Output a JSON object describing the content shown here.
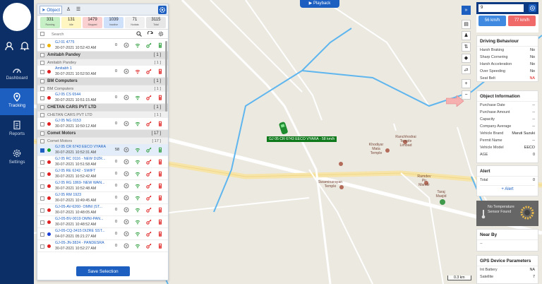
{
  "nav": {
    "items": [
      {
        "label": "Dashboard",
        "icon": "dashboard-icon"
      },
      {
        "label": "Tracking",
        "icon": "tracking-icon"
      },
      {
        "label": "Reports",
        "icon": "reports-icon"
      },
      {
        "label": "Settings",
        "icon": "gear-icon"
      }
    ],
    "active": "Tracking"
  },
  "playback_label": "Playback",
  "panel": {
    "tab_label": "Object",
    "stats": [
      {
        "value": "331",
        "label": "Running",
        "color": "#c7efc5"
      },
      {
        "value": "131",
        "label": "Idle",
        "color": "#fff6c2"
      },
      {
        "value": "1479",
        "label": "Stopped",
        "color": "#fbd0d0"
      },
      {
        "value": "1039",
        "label": "Inactive",
        "color": "#cfe0fa"
      },
      {
        "value": "71",
        "label": "Nodata",
        "color": "#f0f0f0"
      },
      {
        "value": "3115",
        "label": "Total",
        "color": "#e6e6e6"
      }
    ],
    "search_placeholder": "Search",
    "rows": [
      {
        "kind": "veh",
        "name": "GJ 01 4775",
        "time": "30-07-2021 10:52:43 AM",
        "speed": "0",
        "color": "#f0b400"
      },
      {
        "kind": "grp",
        "name": "Amitabh Pandey",
        "count": "[ 1 ]"
      },
      {
        "kind": "sub",
        "name": "Amitabh Pandey",
        "count": "[ 1 ]"
      },
      {
        "kind": "veh",
        "name": "Amitabh 1",
        "time": "30-07-2021 10:52:50 AM",
        "speed": "0",
        "color": "#e02020"
      },
      {
        "kind": "grp",
        "name": "BM Computers",
        "count": "[ 1 ]"
      },
      {
        "kind": "sub",
        "name": "BM Computers",
        "count": "[ 1 ]"
      },
      {
        "kind": "veh",
        "name": "GJ 05 CS 6544",
        "time": "30-07-2021 10:51:15 AM",
        "speed": "0",
        "color": "#e02020"
      },
      {
        "kind": "grp",
        "name": "CHETAN CARS PVT LTD",
        "count": "[ 1 ]"
      },
      {
        "kind": "sub",
        "name": "CHETAN CARS PVT LTD",
        "count": "[ 1 ]"
      },
      {
        "kind": "veh",
        "name": "GJ 05 NG 0153",
        "time": "30-07-2021 10:50:12 AM",
        "speed": "0",
        "color": "#e02020"
      },
      {
        "kind": "grp",
        "name": "Comet Motors",
        "count": "[ 17 ]"
      },
      {
        "kind": "sub",
        "name": "Comet Motors",
        "count": "[ 17 ]"
      },
      {
        "kind": "veh",
        "name": "GJ 05 CR 6743 EECO VYARA",
        "time": "30-07-2021 10:52:31 AM",
        "speed": "58",
        "color": "#13a02a",
        "selected": true
      },
      {
        "kind": "veh",
        "name": "GJ 05 RC 0116 - NEW DIZR...",
        "time": "30-07-2021 10:51:58 AM",
        "speed": "0",
        "color": "#e02020"
      },
      {
        "kind": "veh",
        "name": "GJ 05 RE 6242 - SWIFT",
        "time": "30-07-2021 10:52:42 AM",
        "speed": "0",
        "color": "#e02020"
      },
      {
        "kind": "veh",
        "name": "GJ 05 RG 1869- NEW WAN...",
        "time": "30-07-2021 10:52:48 AM",
        "speed": "0",
        "color": "#e02020"
      },
      {
        "kind": "veh",
        "name": "GJ 05 RM 1923",
        "time": "30-07-2021 10:49:45 AM",
        "speed": "0",
        "color": "#e02020"
      },
      {
        "kind": "veh",
        "name": "GJ-05-AV-6260- OMNI (ST...",
        "time": "30-07-2021 10:48:05 AM",
        "speed": "0",
        "color": "#e02020"
      },
      {
        "kind": "veh",
        "name": "GJ-05-BV-0019 OMNI-PAN...",
        "time": "30-07-2021 10:48:52 AM",
        "speed": "0",
        "color": "#e02020"
      },
      {
        "kind": "veh",
        "name": "GJ-05-CQ-3415 DIZRE SST...",
        "time": "04-07-2021 05:21:27 AM",
        "speed": "0",
        "color": "#1a3fd6"
      },
      {
        "kind": "veh",
        "name": "GJ-05-JN-3824 - PANDESRA",
        "time": "30-07-2021 10:52:27 AM",
        "speed": "0",
        "color": "#e02020"
      }
    ],
    "save_label": "Save Selection"
  },
  "map": {
    "vehicle_label": "GJ 05 CR 6743 EECO VYARA - 58 km/h",
    "places": [
      {
        "name": "Khodiyar\nMata\nTemple"
      },
      {
        "name": "Ranchhodrai\nTemple\nLimbad"
      },
      {
        "name": "Swaminarayan\nTemple"
      },
      {
        "name": "Ramdev\nPir\nMandir"
      },
      {
        "name": "Taraj\nMasjid"
      }
    ],
    "scale": "0.3 km"
  },
  "right": {
    "speeds": [
      "56 km/h",
      "77 km/h"
    ],
    "driving_title": "Driving Behaviour",
    "driving": [
      {
        "k": "Harsh Braking",
        "v": "No"
      },
      {
        "k": "Sharp Cornering",
        "v": "No"
      },
      {
        "k": "Harsh Acceleration",
        "v": "No"
      },
      {
        "k": "Over Speeding",
        "v": "No"
      },
      {
        "k": "Seat Belt",
        "v": "NA"
      }
    ],
    "object_title": "Object Information",
    "object": [
      {
        "k": "Purchase Date",
        "v": "--"
      },
      {
        "k": "Purchase Amount",
        "v": "--"
      },
      {
        "k": "Capacity",
        "v": "--"
      },
      {
        "k": "Company Average",
        "v": "--"
      },
      {
        "k": "Vehicle Brand",
        "v": "Maruti Suzuki"
      },
      {
        "k": "Permit Name",
        "v": "--"
      },
      {
        "k": "Vehicle Model",
        "v": "EECO"
      },
      {
        "k": "AGE",
        "v": "0"
      }
    ],
    "alert_title": "Alert",
    "alert_total_label": "Total",
    "alert_total": "0",
    "alert_btn": "+ Alert",
    "temp_text": "No Temperature Sensor Found",
    "nearby_title": "Near By",
    "nearby_value": "--",
    "gps_title": "GPS Device Parameters",
    "gps": [
      {
        "k": "Int Battery",
        "v": "NA"
      },
      {
        "k": "Satellite",
        "v": "7"
      }
    ]
  }
}
